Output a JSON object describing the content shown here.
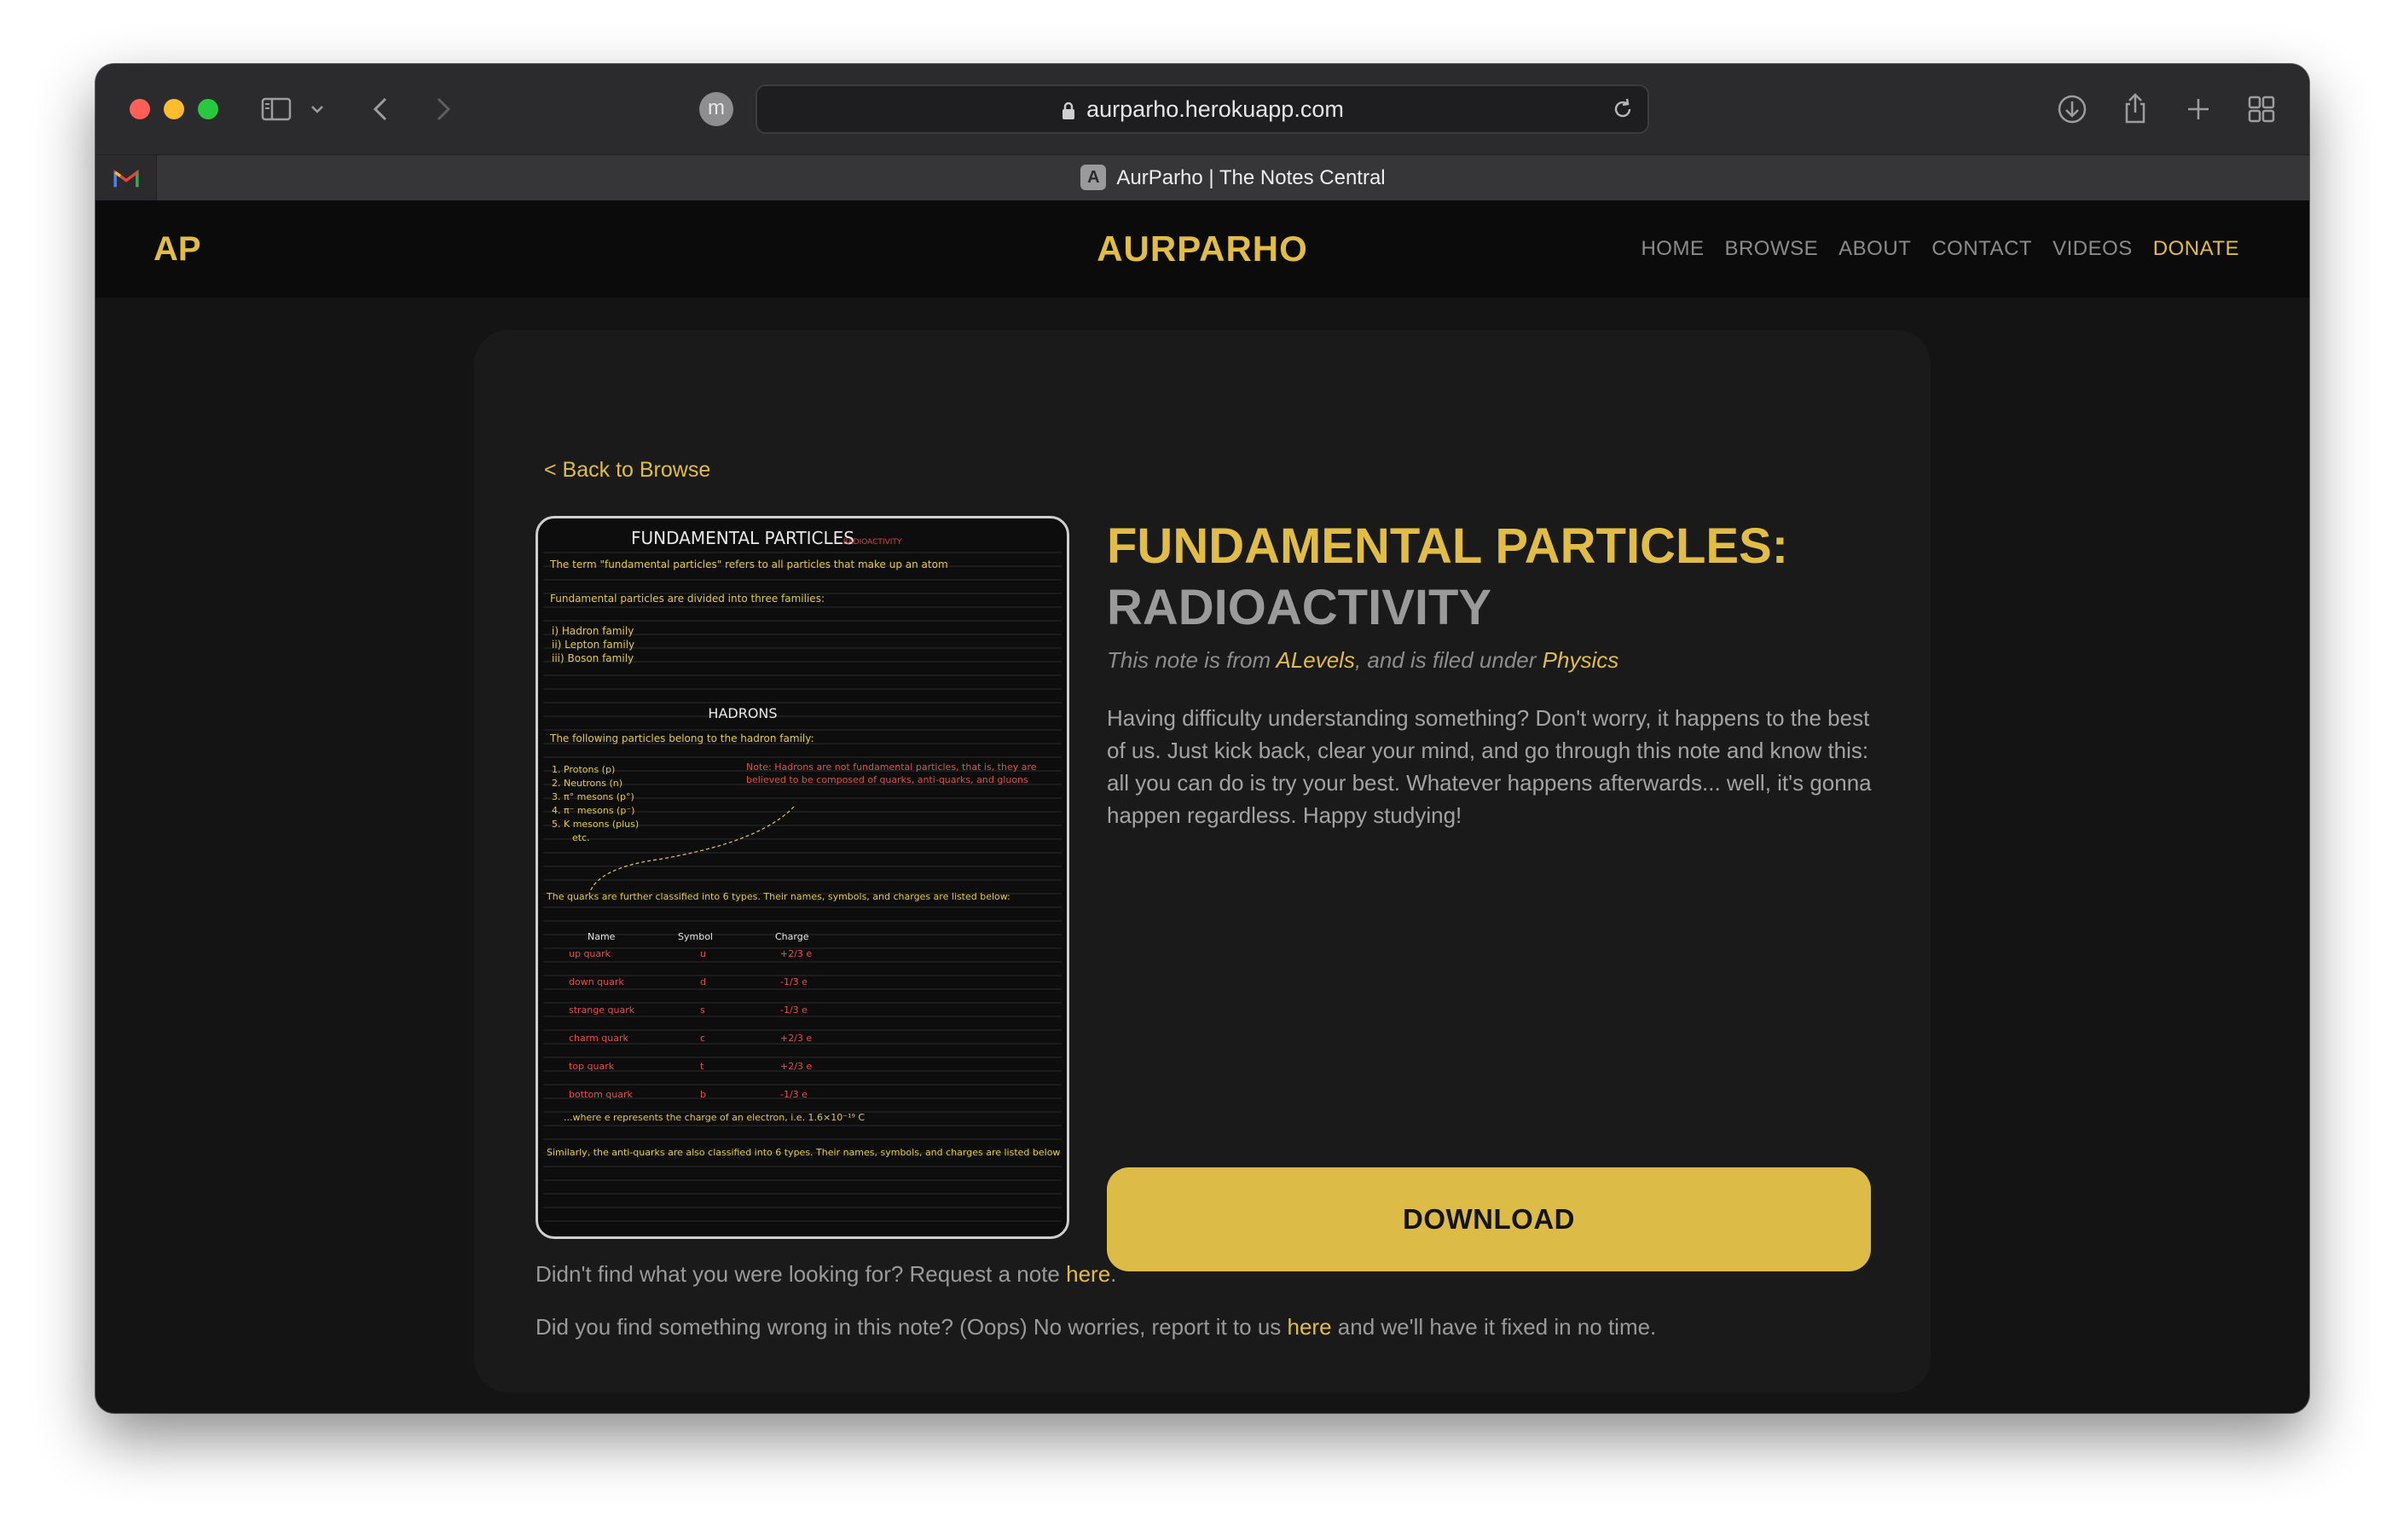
{
  "browser": {
    "url": "aurparho.herokuapp.com",
    "profile_initial": "m",
    "tab_title": "AurParho | The Notes Central",
    "tab_favicon_letter": "A"
  },
  "header": {
    "logo": "AP",
    "brand": "AURPARHO",
    "nav": [
      "HOME",
      "BROWSE",
      "ABOUT",
      "CONTACT",
      "VIDEOS",
      "DONATE"
    ]
  },
  "note": {
    "back_label": "< Back to Browse",
    "title_primary": "FUNDAMENTAL PARTICLES:",
    "title_secondary": "RADIOACTIVITY",
    "meta_prefix": "This note is from ",
    "meta_source": "ALevels",
    "meta_middle": ", and is filed under ",
    "meta_subject": "Physics",
    "description": "Having difficulty understanding something? Don't worry, it happens to the best of us. Just kick back, clear your mind, and go through this note and know this: all you can do is try your best. Whatever happens afterwards... well, it's gonna happen regardless. Happy studying!",
    "download_label": "DOWNLOAD"
  },
  "preview": {
    "heading": "FUNDAMENTAL PARTICLES",
    "heading_tag": "RADIOACTIVITY",
    "intro": "The term \"fundamental particles\" refers to all particles that make up an atom",
    "divided": "Fundamental particles are divided into three families:",
    "families": [
      "i) Hadron family",
      "ii) Lepton family",
      "iii) Boson family"
    ],
    "hadrons_heading": "HADRONS",
    "hadrons_intro": "The following particles belong to the hadron family:",
    "hadron_list": [
      "1. Protons (p)",
      "2. Neutrons (n)",
      "3. π° mesons (p°)",
      "4. π⁻ mesons (p⁻)",
      "5. K mesons (plus)",
      "etc."
    ],
    "hadron_note": "Note: Hadrons are not fundamental particles, that is, they are believed to be composed of quarks, anti-quarks, and gluons",
    "quarks_line": "The quarks are further classified into 6 types. Their names, symbols, and charges are listed below:",
    "table_headers": [
      "Name",
      "Symbol",
      "Charge"
    ],
    "quarks": [
      {
        "name": "up quark",
        "symbol": "u",
        "charge": "+2/3 e"
      },
      {
        "name": "down quark",
        "symbol": "d",
        "charge": "-1/3 e"
      },
      {
        "name": "strange quark",
        "symbol": "s",
        "charge": "-1/3 e"
      },
      {
        "name": "charm quark",
        "symbol": "c",
        "charge": "+2/3 e"
      },
      {
        "name": "top quark",
        "symbol": "t",
        "charge": "+2/3 e"
      },
      {
        "name": "bottom quark",
        "symbol": "b",
        "charge": "-1/3 e"
      }
    ],
    "e_line": "...where e represents the charge of an electron, i.e. 1.6×10⁻¹⁹ C",
    "anti_line": "Similarly, the anti-quarks are also classified into 6 types. Their names, symbols, and charges are listed below"
  },
  "footer": {
    "request_prefix": "Didn't find what you were looking for? Request a note ",
    "request_link": "here",
    "request_suffix": ".",
    "report_prefix": "Did you find something wrong in this note? (Oops) No worries, report it to us ",
    "report_link": "here",
    "report_suffix": " and we'll have it fixed in no time."
  },
  "colors": {
    "accent": "#e2bd45",
    "download_bg": "#dcbc46",
    "card_bg": "#1a1a1a"
  }
}
